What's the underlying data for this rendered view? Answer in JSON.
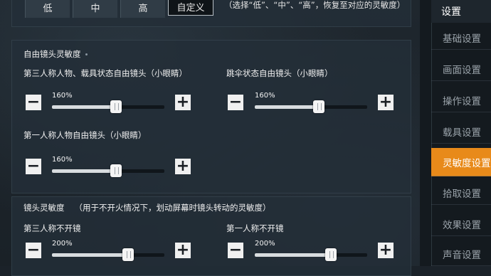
{
  "presets": {
    "options": [
      "低",
      "中",
      "高",
      "自定义"
    ],
    "selected": "自定义",
    "hint": "（选择“低”、“中”、“高”，恢复至对应的灵敏度）"
  },
  "free_camera": {
    "title": "自由镜头灵敏度",
    "controls": [
      {
        "label": "第三人称人物、载具状态自由镜头（小眼睛）",
        "value_text": "160%",
        "level_fraction": 0.57
      },
      {
        "label": "跳伞状态自由镜头（小眼睛）",
        "value_text": "160%",
        "level_fraction": 0.57
      },
      {
        "label": "第一人称人物自由镜头（小眼睛）",
        "value_text": "160%",
        "level_fraction": 0.57
      }
    ]
  },
  "camera": {
    "title": "镜头灵敏度",
    "note": "（用于不开火情况下，划动屏幕时镜头转动的灵敏度）",
    "controls": [
      {
        "label": "第三人称不开镜",
        "value_text": "200%",
        "level_fraction": 0.68
      },
      {
        "label": "第一人称不开镜",
        "value_text": "200%",
        "level_fraction": 0.68
      }
    ]
  },
  "sidebar": {
    "header": "设置",
    "items": [
      "基础设置",
      "画面设置",
      "操作设置",
      "载具设置",
      "灵敏度设置",
      "拾取设置",
      "效果设置",
      "声音设置"
    ],
    "active": "灵敏度设置"
  },
  "colors": {
    "accent": "#e88a1a",
    "panel": "#232e38",
    "button": "#f0f0f0"
  },
  "icons": {
    "minus": "minus-icon",
    "plus": "plus-icon",
    "slider_thumb": "slider-thumb"
  }
}
